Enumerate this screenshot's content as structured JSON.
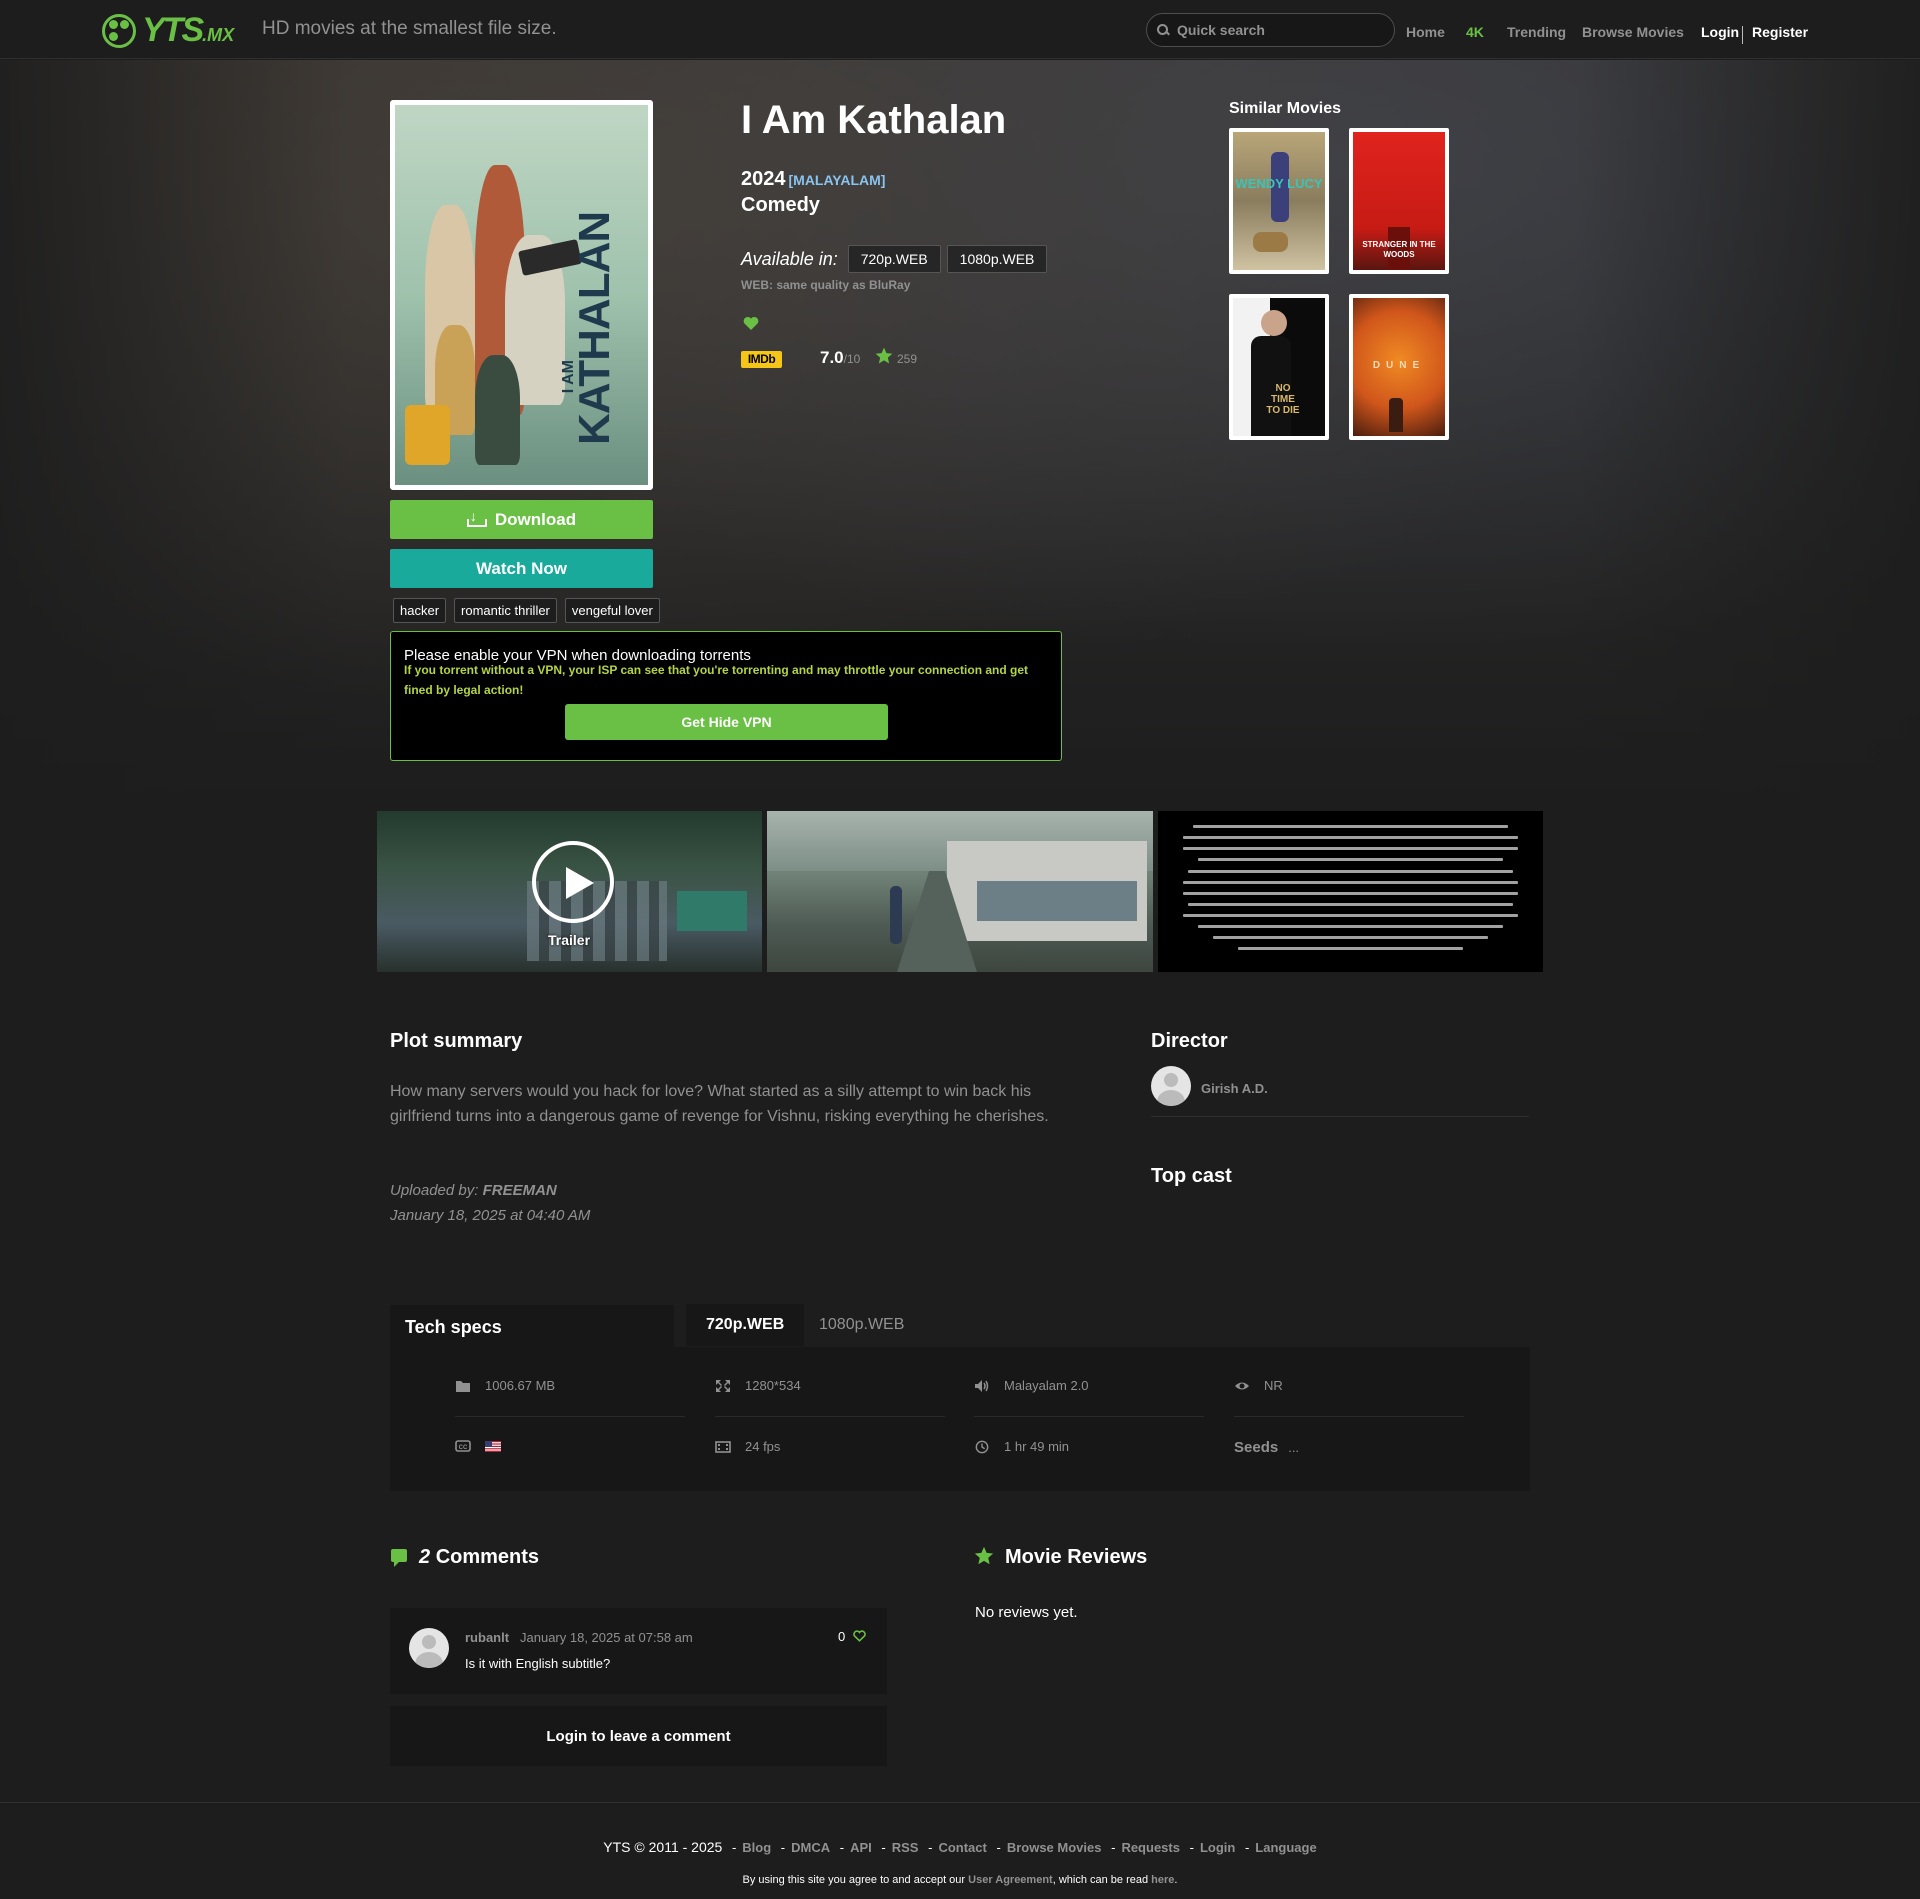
{
  "header": {
    "logo_text": "YTS",
    "logo_suffix": ".MX",
    "tagline": "HD movies at the smallest file size.",
    "search_placeholder": "Quick search",
    "nav": {
      "home": "Home",
      "fourk": "4K",
      "trending": "Trending",
      "browse": "Browse Movies",
      "login": "Login",
      "register": "Register"
    }
  },
  "movie": {
    "title": "I Am Kathalan",
    "year": "2024",
    "language": "[MALAYALAM]",
    "genre": "Comedy",
    "available_label": "Available in:",
    "qualities": [
      "720p.WEB",
      "1080p.WEB"
    ],
    "web_note": "WEB: same quality as BluRay",
    "imdb_label": "IMDb",
    "rating": "7.0",
    "rating_max": "/10",
    "votes": "259",
    "poster_title": "KATHALAN",
    "poster_small": "I AM"
  },
  "actions": {
    "download": "Download",
    "watch_now": "Watch Now"
  },
  "tags": [
    "hacker",
    "romantic thriller",
    "vengeful lover"
  ],
  "vpn": {
    "title": "Please enable your VPN when downloading torrents",
    "warning": "If you torrent without a VPN, your ISP can see that you're torrenting and may throttle your connection and get fined by legal action!",
    "button": "Get Hide VPN"
  },
  "similar": {
    "label": "Similar Movies",
    "items": [
      {
        "poster_text": "WENDY LUCY"
      },
      {
        "poster_text": "STRANGER IN THE WOODS"
      },
      {
        "poster_text": "NO TIME TO DIE"
      },
      {
        "poster_text": "DUNE"
      }
    ]
  },
  "screenshots": {
    "trailer_label": "Trailer"
  },
  "plot": {
    "heading": "Plot summary",
    "text": "How many servers would you hack for love? What started as a silly attempt to win back his girlfriend turns into a dangerous game of revenge for Vishnu, risking everything he cherishes.",
    "uploaded_by_label": "Uploaded by:",
    "uploader": "FREEMAN",
    "upload_date": "January 18, 2025 at 04:40 AM"
  },
  "director": {
    "heading": "Director",
    "name": "Girish A.D."
  },
  "top_cast": {
    "heading": "Top cast"
  },
  "tech_specs": {
    "heading": "Tech specs",
    "tabs": [
      "720p.WEB",
      "1080p.WEB"
    ],
    "size": "1006.67 MB",
    "resolution": "1280*534",
    "audio": "Malayalam 2.0",
    "rating": "NR",
    "subtitles_flag": "US",
    "fps": "24 fps",
    "runtime": "1 hr 49 min",
    "seeds_label": "Seeds",
    "seeds_value": "..."
  },
  "comments": {
    "count": "2",
    "label": "Comments",
    "items": [
      {
        "user": "rubanlt",
        "date": "January 18, 2025 at 07:58 am",
        "text": "Is it with English subtitle?",
        "likes": "0"
      }
    ],
    "login_prompt": "Login to leave a comment"
  },
  "reviews": {
    "heading": "Movie Reviews",
    "empty": "No reviews yet."
  },
  "footer": {
    "copyright": "YTS © 2011 - 2025",
    "links": [
      "Blog",
      "DMCA",
      "API",
      "RSS",
      "Contact",
      "Browse Movies",
      "Requests",
      "Login",
      "Language"
    ],
    "note_prefix": "By using this site you agree to and accept our ",
    "note_link": "User Agreement",
    "note_middle": ", which can be read ",
    "note_here": "here",
    "note_end": "."
  },
  "colors": {
    "accent_green": "#6ac045",
    "watch_teal": "#1aaa9b",
    "imdb_yellow": "#f5c518",
    "text_muted": "#919191",
    "background": "#1d1d1d"
  }
}
